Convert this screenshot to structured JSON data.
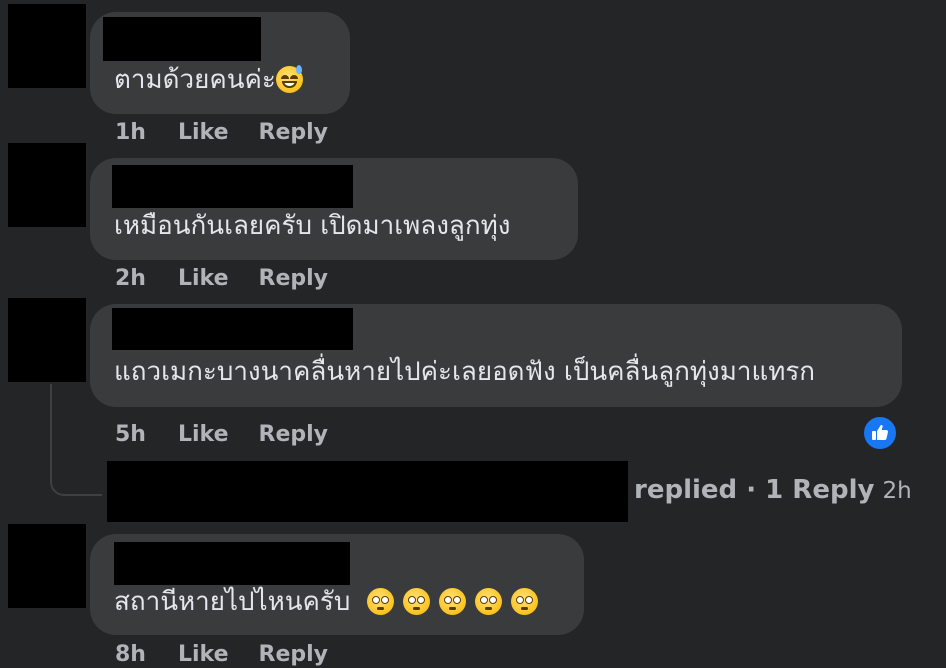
{
  "comments": [
    {
      "text": "ตามด้วยคนค่ะ",
      "emoji": "grinning-sweat-emoji",
      "time": "1h",
      "like_label": "Like",
      "reply_label": "Reply"
    },
    {
      "text": "เหมือนกันเลยครับ เปิดมาเพลงลูกทุ่ง",
      "time": "2h",
      "like_label": "Like",
      "reply_label": "Reply"
    },
    {
      "text": "แถวเมกะบางนาคลื่นหายไปค่ะเลยอดฟัง เป็นคลื่นลูกทุ่งมาแทรก",
      "time": "5h",
      "like_label": "Like",
      "reply_label": "Reply",
      "reaction": "like-reaction-icon"
    },
    {
      "text": "สถานีหายไปไหนครับ",
      "emoji": "flushed-emoji",
      "emoji_count": 5,
      "time": "8h",
      "like_label": "Like",
      "reply_label": "Reply"
    }
  ],
  "reply_thread": {
    "replied_label": "replied",
    "separator": "·",
    "count_label": "1 Reply",
    "time": "2h"
  },
  "colors": {
    "background": "#242526",
    "bubble": "#3a3b3c",
    "text": "#e4e6eb",
    "secondary": "#b0b3b8",
    "like_blue": "#1877f2"
  }
}
